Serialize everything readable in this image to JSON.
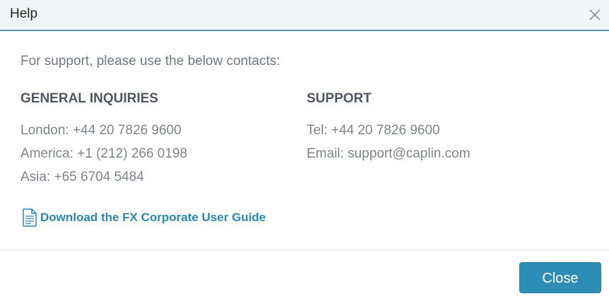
{
  "dialog": {
    "title": "Help",
    "intro": "For support, please use the below contacts:",
    "general": {
      "heading": "GENERAL INQUIRIES",
      "lines": [
        "London: +44 20 7826 9600",
        "America: +1 (212) 266 0198",
        "Asia: +65 6704 5484"
      ]
    },
    "support": {
      "heading": "SUPPORT",
      "lines": [
        "Tel: +44 20 7826 9600",
        "Email: support@caplin.com"
      ]
    },
    "download": {
      "label": "Download the FX Corporate User Guide",
      "icon": "document-icon"
    },
    "footer": {
      "close_label": "Close"
    },
    "colors": {
      "accent": "#2d8db4",
      "link": "#2b89ad",
      "title_border": "#5b8fa8"
    }
  }
}
